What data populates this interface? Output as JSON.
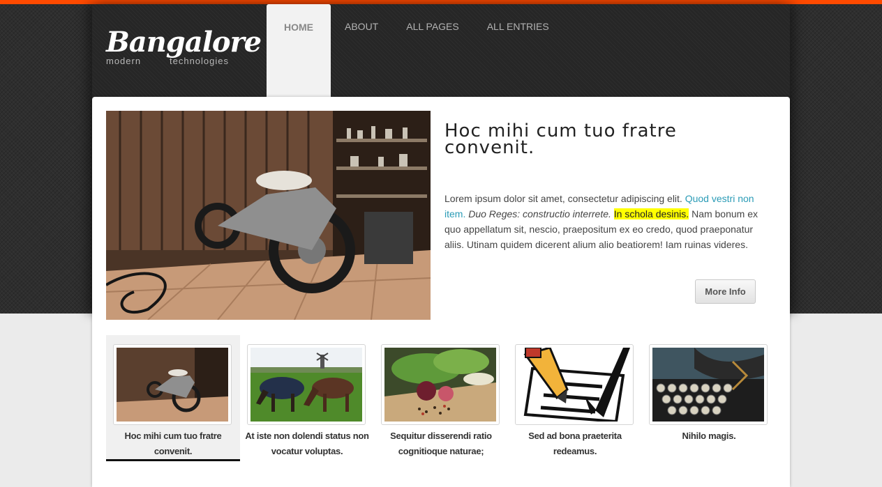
{
  "brand": {
    "name": "Bangalore",
    "tagline_left": "modern",
    "tagline_right": "technologies"
  },
  "nav": [
    {
      "label": "HOME",
      "active": true
    },
    {
      "label": "ABOUT",
      "active": false
    },
    {
      "label": "ALL PAGES",
      "active": false
    },
    {
      "label": "ALL ENTRIES",
      "active": false
    }
  ],
  "hero": {
    "heading": "Hoc mihi cum tuo fratre convenit.",
    "text_1": "Lorem ipsum dolor sit amet, consectetur adipiscing elit. ",
    "link": "Quod vestri non item.",
    "text_2": " ",
    "italic": "Duo Reges: constructio interrete.",
    "text_3": " ",
    "highlight": "In schola desinis.",
    "text_4": " Nam bonum ex quo appellatum sit, nescio, praepositum ex eo credo, quod praeponatur aliis. Utinam quidem dicerent alium alio beatiorem! Iam ruinas videres.",
    "button": "More Info"
  },
  "thumbnails": [
    {
      "caption": "Hoc mihi cum tuo fratre convenit.",
      "image": "motorcycle-garage",
      "active": true
    },
    {
      "caption": "At iste non dolendi status non vocatur voluptas.",
      "image": "grazing-horses",
      "active": false
    },
    {
      "caption": "Sequitur disserendi ratio cognitioque naturae;",
      "image": "vegetables-spices",
      "active": false
    },
    {
      "caption": "Sed ad bona praeterita redeamus.",
      "image": "checklist-pencil-clipart",
      "active": false
    },
    {
      "caption": "Nihilo magis.",
      "image": "vintage-typewriter",
      "active": false
    }
  ],
  "colors": {
    "accent_stripe": "#ff4a00",
    "link": "#2a9bb6",
    "highlight": "#ffff00"
  }
}
